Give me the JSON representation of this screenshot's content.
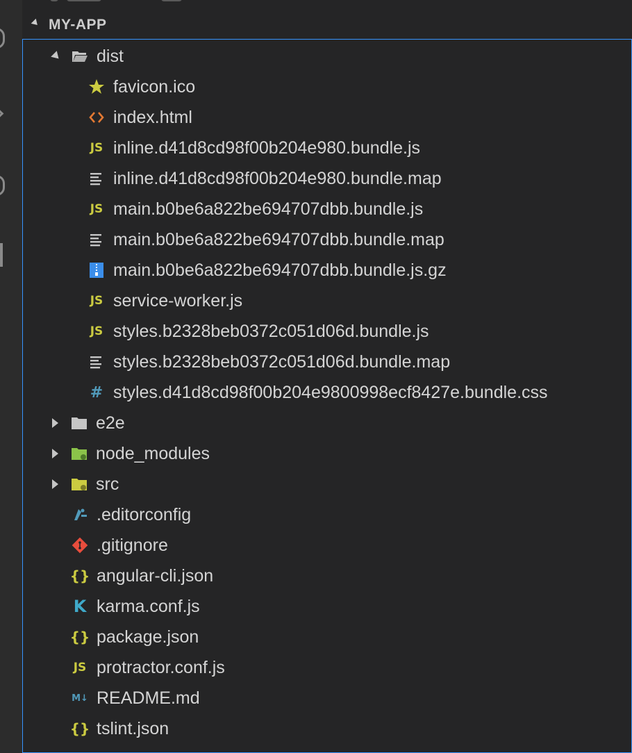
{
  "explorer": {
    "section_title": "MY-APP"
  },
  "tree": {
    "dist": {
      "label": "dist",
      "children": [
        {
          "label": "favicon.ico",
          "icon": "star-icon"
        },
        {
          "label": "index.html",
          "icon": "html-icon"
        },
        {
          "label": "inline.d41d8cd98f00b204e980.bundle.js",
          "icon": "js-icon"
        },
        {
          "label": "inline.d41d8cd98f00b204e980.bundle.map",
          "icon": "map-file-icon"
        },
        {
          "label": "main.b0be6a822be694707dbb.bundle.js",
          "icon": "js-icon"
        },
        {
          "label": "main.b0be6a822be694707dbb.bundle.map",
          "icon": "map-file-icon"
        },
        {
          "label": "main.b0be6a822be694707dbb.bundle.js.gz",
          "icon": "zip-icon"
        },
        {
          "label": "service-worker.js",
          "icon": "js-icon"
        },
        {
          "label": "styles.b2328beb0372c051d06d.bundle.js",
          "icon": "js-icon"
        },
        {
          "label": "styles.b2328beb0372c051d06d.bundle.map",
          "icon": "map-file-icon"
        },
        {
          "label": "styles.d41d8cd98f00b204e9800998ecf8427e.bundle.css",
          "icon": "css-icon"
        }
      ]
    },
    "folders": [
      {
        "label": "e2e",
        "icon": "folder-icon"
      },
      {
        "label": "node_modules",
        "icon": "node-folder-icon"
      },
      {
        "label": "src",
        "icon": "src-folder-icon"
      }
    ],
    "files": [
      {
        "label": ".editorconfig",
        "icon": "editorconfig-icon"
      },
      {
        "label": ".gitignore",
        "icon": "git-icon"
      },
      {
        "label": "angular-cli.json",
        "icon": "json-icon"
      },
      {
        "label": "karma.conf.js",
        "icon": "karma-icon"
      },
      {
        "label": "package.json",
        "icon": "json-icon"
      },
      {
        "label": "protractor.conf.js",
        "icon": "js-icon"
      },
      {
        "label": "README.md",
        "icon": "markdown-icon"
      },
      {
        "label": "tslint.json",
        "icon": "json-icon"
      }
    ]
  },
  "colors": {
    "js": "#cbcb41",
    "html": "#e37933",
    "css": "#519aba",
    "json": "#cbcb41",
    "git": "#e84d3d",
    "star": "#cbcb41",
    "focus_border": "#3794ff"
  }
}
